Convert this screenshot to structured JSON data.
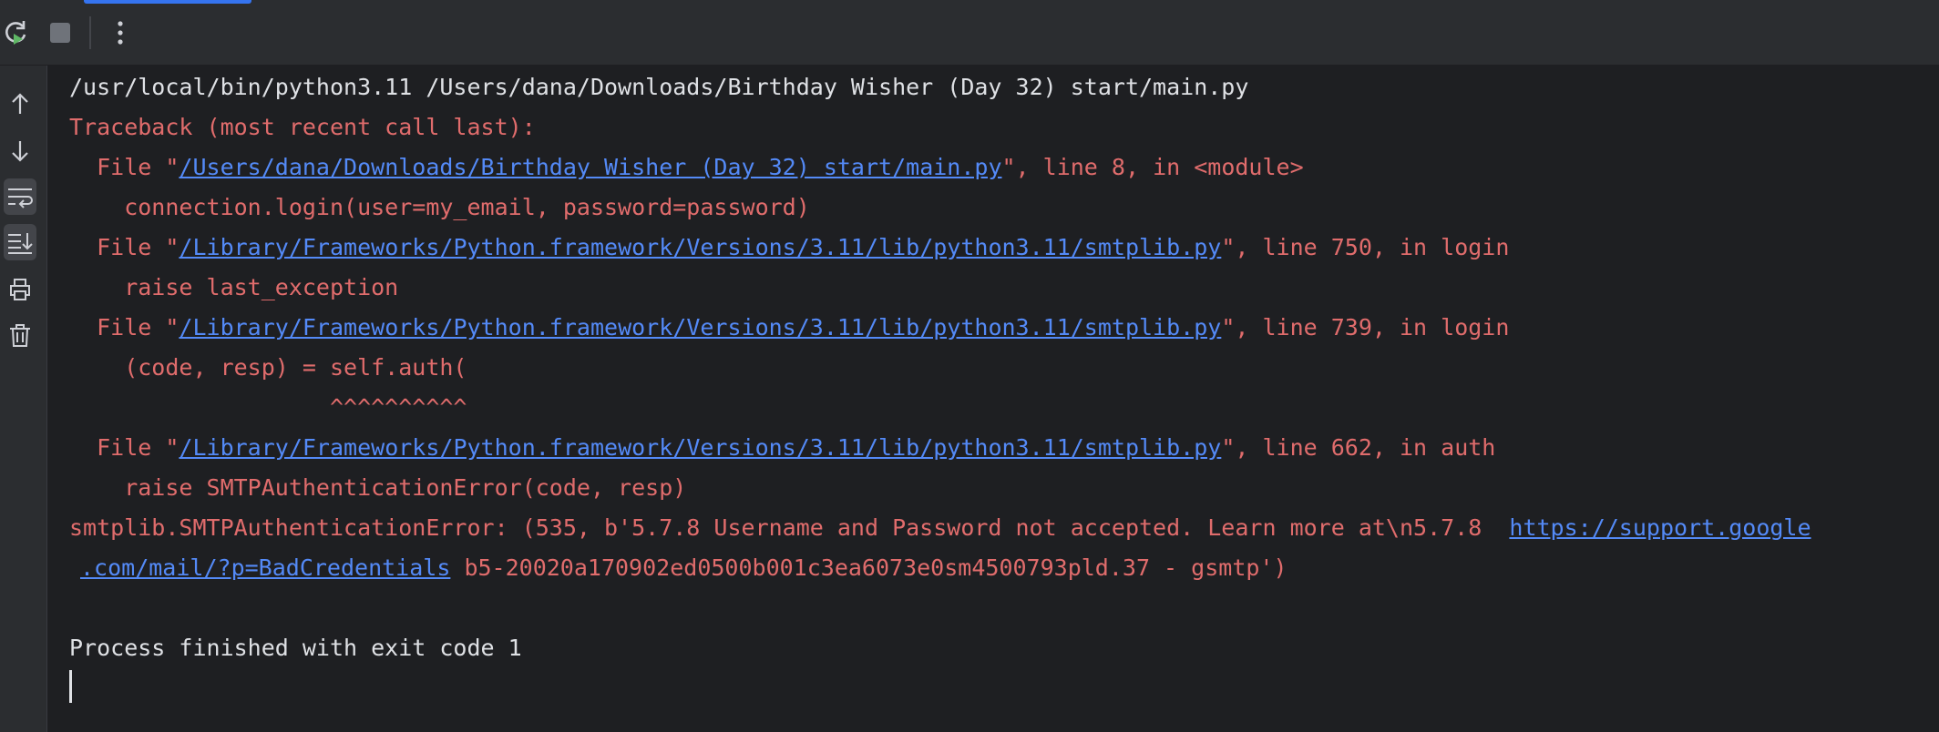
{
  "colors": {
    "error_text": "#e06c6c",
    "plain_text": "#dfe1e5",
    "link": "#548af7",
    "background": "#1e1f22",
    "panel": "#2b2d30"
  },
  "toolbar": {
    "rerun_icon": "rerun-icon",
    "stop_icon": "stop-icon",
    "more_icon": "more-options-icon"
  },
  "sidebar": {
    "items": [
      {
        "icon": "arrow-up-icon"
      },
      {
        "icon": "arrow-down-icon"
      },
      {
        "icon": "soft-wrap-icon"
      },
      {
        "icon": "scroll-to-end-icon"
      },
      {
        "icon": "print-icon"
      },
      {
        "icon": "trash-icon"
      }
    ]
  },
  "console": {
    "command": "/usr/local/bin/python3.11 /Users/dana/Downloads/Birthday Wisher (Day 32) start/main.py",
    "traceback_header": "Traceback (most recent call last):",
    "frame1_pre": "  File \"",
    "frame1_path": "/Users/dana/Downloads/Birthday Wisher (Day 32) start/main.py",
    "frame1_post": "\", line 8, in <module>",
    "frame1_code": "    connection.login(user=my_email, password=password)",
    "frame2_pre": "  File \"",
    "frame2_path": "/Library/Frameworks/Python.framework/Versions/3.11/lib/python3.11/smtplib.py",
    "frame2_post": "\", line 750, in login",
    "frame2_code": "    raise last_exception",
    "frame3_pre": "  File \"",
    "frame3_path": "/Library/Frameworks/Python.framework/Versions/3.11/lib/python3.11/smtplib.py",
    "frame3_post": "\", line 739, in login",
    "frame3_code": "    (code, resp) = self.auth(",
    "frame3_carets": "                   ^^^^^^^^^^",
    "frame4_pre": "  File \"",
    "frame4_path": "/Library/Frameworks/Python.framework/Versions/3.11/lib/python3.11/smtplib.py",
    "frame4_post": "\", line 662, in auth",
    "frame4_code": "    raise SMTPAuthenticationError(code, resp)",
    "error_pre": "smtplib.SMTPAuthenticationError: (535, b'5.7.8 Username and Password not accepted. Learn more at\\n5.7.8  ",
    "error_link_a": "https://support.google",
    "error_link_b": ".com/mail/?p=BadCredentials",
    "error_post": " b5-20020a170902ed0500b001c3ea6073e0sm4500793pld.37 - gsmtp')",
    "exit_message": "Process finished with exit code 1"
  }
}
